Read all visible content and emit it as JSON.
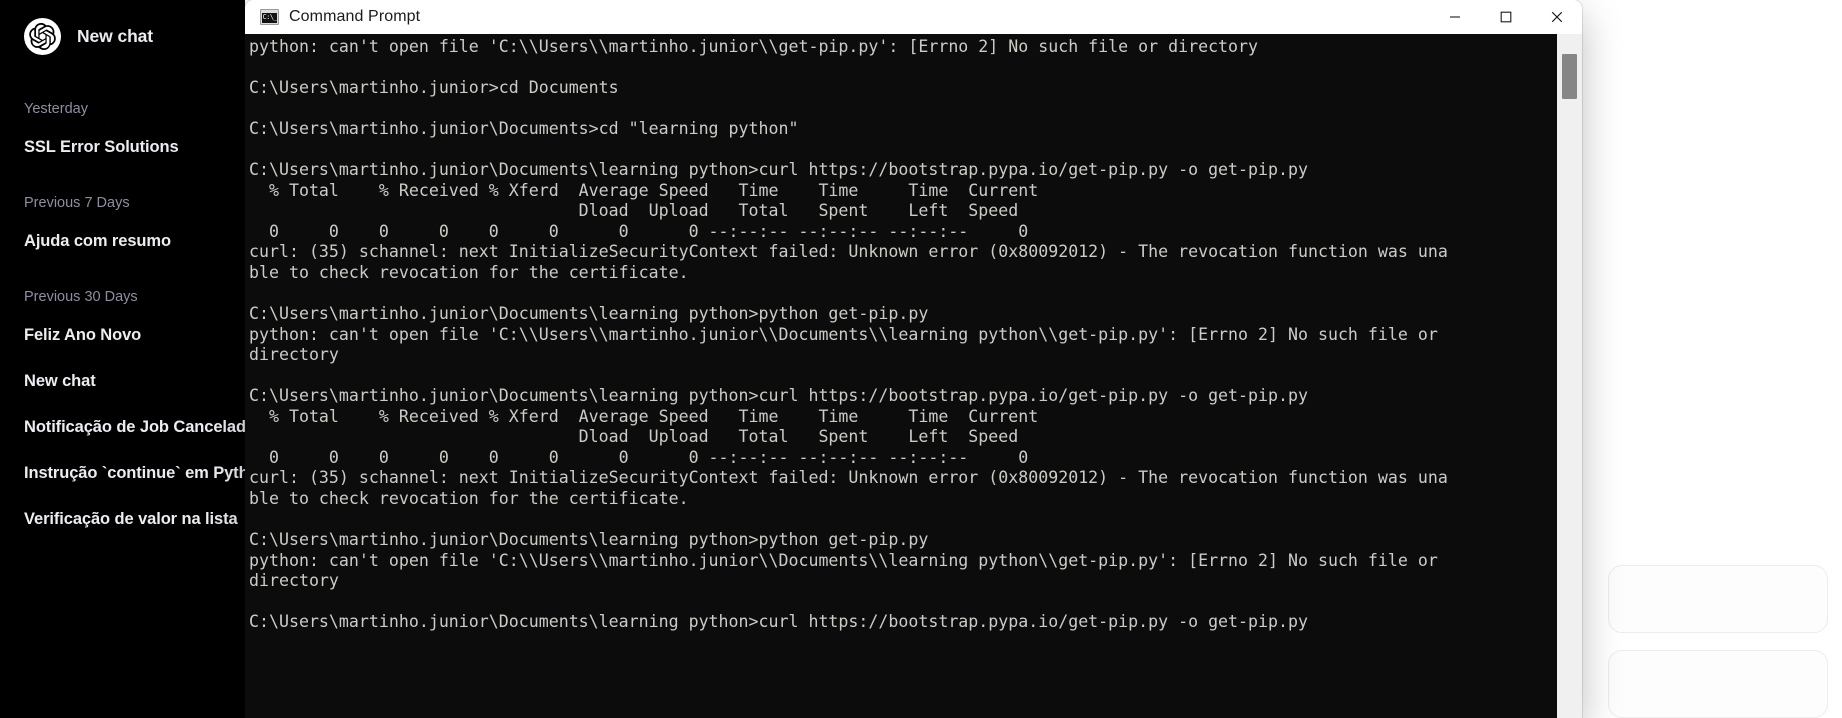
{
  "sidebar": {
    "brand": {
      "label": "New chat",
      "logo_icon": "openai-logo-icon"
    },
    "groups": [
      {
        "title": "Yesterday",
        "items": [
          {
            "label": "SSL Error Solutions"
          }
        ]
      },
      {
        "title": "Previous 7 Days",
        "items": [
          {
            "label": "Ajuda com resumo"
          }
        ]
      },
      {
        "title": "Previous 30 Days",
        "items": [
          {
            "label": "Feliz Ano Novo"
          },
          {
            "label": "New chat"
          },
          {
            "label": "Notificação de Job Cancelado"
          },
          {
            "label": "Instrução `continue` em Python"
          },
          {
            "label": "Verificação de valor na lista"
          }
        ]
      }
    ],
    "background_color": "#000000",
    "text_color": "#ececf1",
    "muted_color": "#8e8ea0"
  },
  "window": {
    "title": "Command Prompt",
    "icon": "cmd-icon",
    "controls": {
      "minimize_label": "Minimize",
      "maximize_label": "Maximize",
      "close_label": "Close"
    }
  },
  "terminal": {
    "background_color": "#0c0c0c",
    "text_color": "#ccccc7",
    "lines": [
      "python: can't open file 'C:\\\\Users\\\\martinho.junior\\\\get-pip.py': [Errno 2] No such file or directory",
      "",
      "C:\\Users\\martinho.junior>cd Documents",
      "",
      "C:\\Users\\martinho.junior\\Documents>cd \"learning python\"",
      "",
      "C:\\Users\\martinho.junior\\Documents\\learning python>curl https://bootstrap.pypa.io/get-pip.py -o get-pip.py",
      "  % Total    % Received % Xferd  Average Speed   Time    Time     Time  Current",
      "                                 Dload  Upload   Total   Spent    Left  Speed",
      "  0     0    0     0    0     0      0      0 --:--:-- --:--:-- --:--:--     0",
      "curl: (35) schannel: next InitializeSecurityContext failed: Unknown error (0x80092012) - The revocation function was una",
      "ble to check revocation for the certificate.",
      "",
      "C:\\Users\\martinho.junior\\Documents\\learning python>python get-pip.py",
      "python: can't open file 'C:\\\\Users\\\\martinho.junior\\\\Documents\\\\learning python\\\\get-pip.py': [Errno 2] No such file or",
      "directory",
      "",
      "C:\\Users\\martinho.junior\\Documents\\learning python>curl https://bootstrap.pypa.io/get-pip.py -o get-pip.py",
      "  % Total    % Received % Xferd  Average Speed   Time    Time     Time  Current",
      "                                 Dload  Upload   Total   Spent    Left  Speed",
      "  0     0    0     0    0     0      0      0 --:--:-- --:--:-- --:--:--     0",
      "curl: (35) schannel: next InitializeSecurityContext failed: Unknown error (0x80092012) - The revocation function was una",
      "ble to check revocation for the certificate.",
      "",
      "C:\\Users\\martinho.junior\\Documents\\learning python>python get-pip.py",
      "python: can't open file 'C:\\\\Users\\\\martinho.junior\\\\Documents\\\\learning python\\\\get-pip.py': [Errno 2] No such file or",
      "directory",
      "",
      "C:\\Users\\martinho.junior\\Documents\\learning python>curl https://bootstrap.pypa.io/get-pip.py -o get-pip.py"
    ],
    "scrollbar": {
      "thumb_color": "#868686",
      "track_color": "#f0f0f0"
    }
  }
}
